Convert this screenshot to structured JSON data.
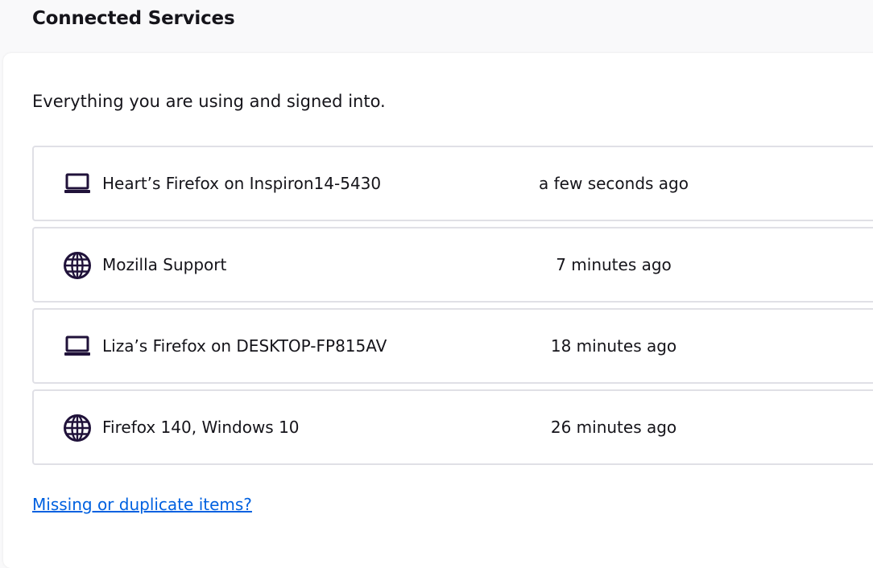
{
  "header": {
    "title": "Connected Services"
  },
  "intro": "Everything you are using and signed into.",
  "services": [
    {
      "icon": "laptop-icon",
      "name": "Heart’s Firefox on Inspiron14-5430",
      "last_active": "a few seconds ago"
    },
    {
      "icon": "globe-icon",
      "name": "Mozilla Support",
      "last_active": "7 minutes ago"
    },
    {
      "icon": "laptop-icon",
      "name": "Liza’s Firefox on DESKTOP-FP815AV",
      "last_active": "18 minutes ago"
    },
    {
      "icon": "globe-icon",
      "name": "Firefox 140, Windows 10",
      "last_active": "26 minutes ago"
    }
  ],
  "help_link": "Missing or duplicate items?",
  "colors": {
    "icon": "#20123a",
    "link": "#0061e0",
    "text": "#15141a",
    "border": "#e0e0e6"
  }
}
